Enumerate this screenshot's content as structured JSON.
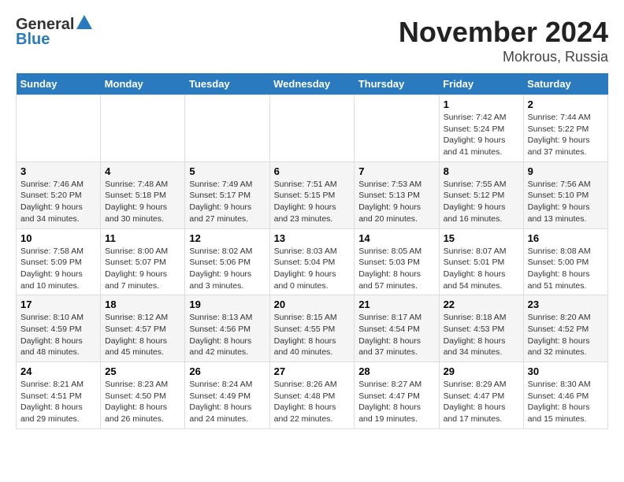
{
  "logo": {
    "general": "General",
    "blue": "Blue"
  },
  "title": "November 2024",
  "subtitle": "Mokrous, Russia",
  "weekdays": [
    "Sunday",
    "Monday",
    "Tuesday",
    "Wednesday",
    "Thursday",
    "Friday",
    "Saturday"
  ],
  "weeks": [
    [
      {
        "day": "",
        "info": ""
      },
      {
        "day": "",
        "info": ""
      },
      {
        "day": "",
        "info": ""
      },
      {
        "day": "",
        "info": ""
      },
      {
        "day": "",
        "info": ""
      },
      {
        "day": "1",
        "info": "Sunrise: 7:42 AM\nSunset: 5:24 PM\nDaylight: 9 hours and 41 minutes."
      },
      {
        "day": "2",
        "info": "Sunrise: 7:44 AM\nSunset: 5:22 PM\nDaylight: 9 hours and 37 minutes."
      }
    ],
    [
      {
        "day": "3",
        "info": "Sunrise: 7:46 AM\nSunset: 5:20 PM\nDaylight: 9 hours and 34 minutes."
      },
      {
        "day": "4",
        "info": "Sunrise: 7:48 AM\nSunset: 5:18 PM\nDaylight: 9 hours and 30 minutes."
      },
      {
        "day": "5",
        "info": "Sunrise: 7:49 AM\nSunset: 5:17 PM\nDaylight: 9 hours and 27 minutes."
      },
      {
        "day": "6",
        "info": "Sunrise: 7:51 AM\nSunset: 5:15 PM\nDaylight: 9 hours and 23 minutes."
      },
      {
        "day": "7",
        "info": "Sunrise: 7:53 AM\nSunset: 5:13 PM\nDaylight: 9 hours and 20 minutes."
      },
      {
        "day": "8",
        "info": "Sunrise: 7:55 AM\nSunset: 5:12 PM\nDaylight: 9 hours and 16 minutes."
      },
      {
        "day": "9",
        "info": "Sunrise: 7:56 AM\nSunset: 5:10 PM\nDaylight: 9 hours and 13 minutes."
      }
    ],
    [
      {
        "day": "10",
        "info": "Sunrise: 7:58 AM\nSunset: 5:09 PM\nDaylight: 9 hours and 10 minutes."
      },
      {
        "day": "11",
        "info": "Sunrise: 8:00 AM\nSunset: 5:07 PM\nDaylight: 9 hours and 7 minutes."
      },
      {
        "day": "12",
        "info": "Sunrise: 8:02 AM\nSunset: 5:06 PM\nDaylight: 9 hours and 3 minutes."
      },
      {
        "day": "13",
        "info": "Sunrise: 8:03 AM\nSunset: 5:04 PM\nDaylight: 9 hours and 0 minutes."
      },
      {
        "day": "14",
        "info": "Sunrise: 8:05 AM\nSunset: 5:03 PM\nDaylight: 8 hours and 57 minutes."
      },
      {
        "day": "15",
        "info": "Sunrise: 8:07 AM\nSunset: 5:01 PM\nDaylight: 8 hours and 54 minutes."
      },
      {
        "day": "16",
        "info": "Sunrise: 8:08 AM\nSunset: 5:00 PM\nDaylight: 8 hours and 51 minutes."
      }
    ],
    [
      {
        "day": "17",
        "info": "Sunrise: 8:10 AM\nSunset: 4:59 PM\nDaylight: 8 hours and 48 minutes."
      },
      {
        "day": "18",
        "info": "Sunrise: 8:12 AM\nSunset: 4:57 PM\nDaylight: 8 hours and 45 minutes."
      },
      {
        "day": "19",
        "info": "Sunrise: 8:13 AM\nSunset: 4:56 PM\nDaylight: 8 hours and 42 minutes."
      },
      {
        "day": "20",
        "info": "Sunrise: 8:15 AM\nSunset: 4:55 PM\nDaylight: 8 hours and 40 minutes."
      },
      {
        "day": "21",
        "info": "Sunrise: 8:17 AM\nSunset: 4:54 PM\nDaylight: 8 hours and 37 minutes."
      },
      {
        "day": "22",
        "info": "Sunrise: 8:18 AM\nSunset: 4:53 PM\nDaylight: 8 hours and 34 minutes."
      },
      {
        "day": "23",
        "info": "Sunrise: 8:20 AM\nSunset: 4:52 PM\nDaylight: 8 hours and 32 minutes."
      }
    ],
    [
      {
        "day": "24",
        "info": "Sunrise: 8:21 AM\nSunset: 4:51 PM\nDaylight: 8 hours and 29 minutes."
      },
      {
        "day": "25",
        "info": "Sunrise: 8:23 AM\nSunset: 4:50 PM\nDaylight: 8 hours and 26 minutes."
      },
      {
        "day": "26",
        "info": "Sunrise: 8:24 AM\nSunset: 4:49 PM\nDaylight: 8 hours and 24 minutes."
      },
      {
        "day": "27",
        "info": "Sunrise: 8:26 AM\nSunset: 4:48 PM\nDaylight: 8 hours and 22 minutes."
      },
      {
        "day": "28",
        "info": "Sunrise: 8:27 AM\nSunset: 4:47 PM\nDaylight: 8 hours and 19 minutes."
      },
      {
        "day": "29",
        "info": "Sunrise: 8:29 AM\nSunset: 4:47 PM\nDaylight: 8 hours and 17 minutes."
      },
      {
        "day": "30",
        "info": "Sunrise: 8:30 AM\nSunset: 4:46 PM\nDaylight: 8 hours and 15 minutes."
      }
    ]
  ]
}
